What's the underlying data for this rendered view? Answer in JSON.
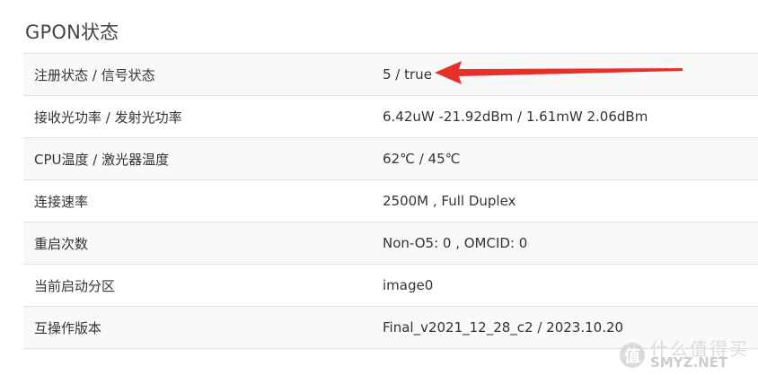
{
  "section": {
    "title": "GPON状态"
  },
  "rows": [
    {
      "label": "注册状态 / 信号状态",
      "value": "5 / true"
    },
    {
      "label": "接收光功率 / 发射光功率",
      "value": "6.42uW -21.92dBm / 1.61mW 2.06dBm"
    },
    {
      "label": "CPU温度 / 激光器温度",
      "value": "62℃ / 45℃"
    },
    {
      "label": "连接速率",
      "value": "2500M , Full Duplex"
    },
    {
      "label": "重启次数",
      "value": "Non-O5: 0 , OMCID: 0"
    },
    {
      "label": "当前启动分区",
      "value": "image0"
    },
    {
      "label": "互操作版本",
      "value": "Final_v2021_12_28_c2 / 2023.10.20"
    }
  ],
  "annotation": {
    "color": "#e8302a",
    "icon": "arrow-left-icon"
  },
  "watermark": {
    "logo_glyph": "值",
    "text_cn": "什么值得买",
    "text_en": "SMYZ.NET"
  }
}
